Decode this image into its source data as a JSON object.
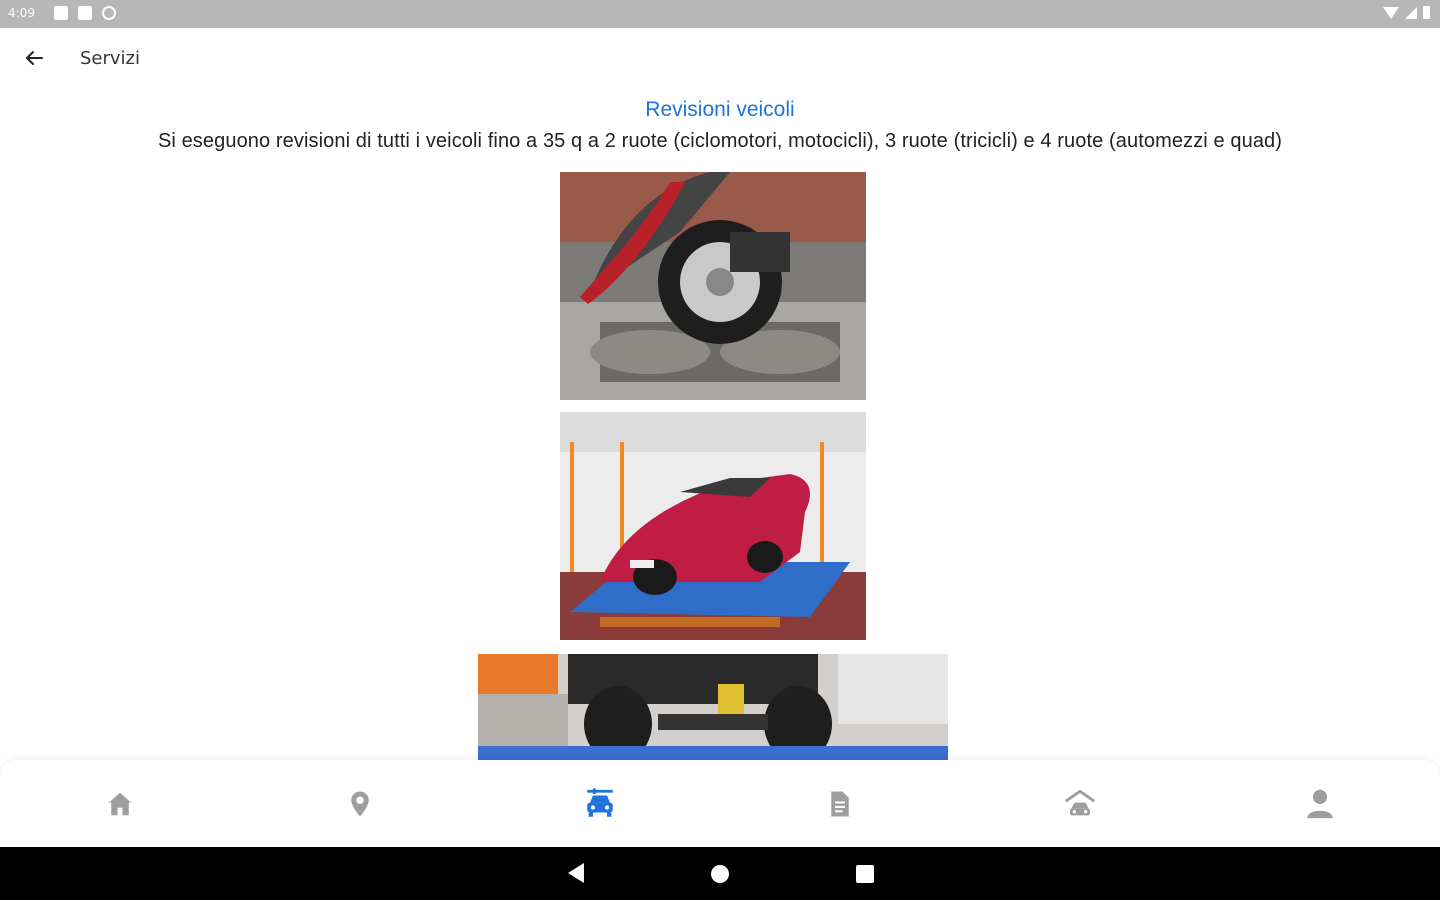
{
  "status_bar": {
    "time": "4:09"
  },
  "app_bar": {
    "title": "Servizi"
  },
  "content": {
    "heading": "Revisioni veicoli",
    "description": "Si eseguono revisioni di tutti i veicoli fino a 35 q a 2 ruote (ciclomotori, motocicli), 3 ruote (tricicli) e 4 ruote (automezzi e quad)"
  },
  "bottom_nav": {
    "items": [
      {
        "icon": "home-icon",
        "active": false
      },
      {
        "icon": "location-pin-icon",
        "active": false
      },
      {
        "icon": "car-service-icon",
        "active": true
      },
      {
        "icon": "document-icon",
        "active": false
      },
      {
        "icon": "garage-car-icon",
        "active": false
      },
      {
        "icon": "person-icon",
        "active": false
      }
    ]
  },
  "colors": {
    "accent": "#1e74d8",
    "inactive_icon": "#9e9e9e",
    "statusbar": "#b7b7b7"
  }
}
